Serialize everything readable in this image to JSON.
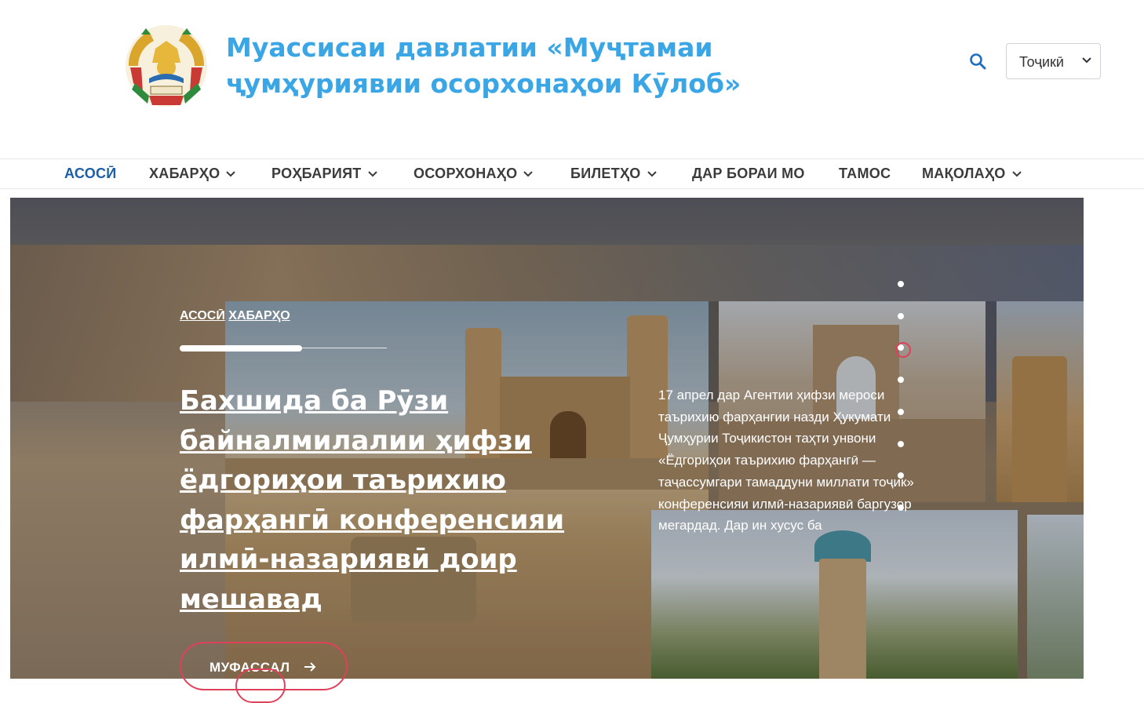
{
  "header": {
    "title_line1": "Муассисаи давлатии «Муҷтамаи",
    "title_line2": "ҷумҳуриявии осорхонаҳои Кӯлоб»",
    "brand_color": "#3aa6e6",
    "search_icon": "search-icon",
    "language_select": {
      "value": "Тоҷикӣ"
    }
  },
  "nav": {
    "items": [
      {
        "label": "АСОСӢ",
        "active": true,
        "dropdown": false
      },
      {
        "label": "ХАБАРҲО",
        "dropdown": true
      },
      {
        "label": "РОҲБАРИЯТ",
        "dropdown": true
      },
      {
        "label": "ОСОРХОНАҲО",
        "dropdown": true
      },
      {
        "label": "БИЛЕТҲО",
        "dropdown": true
      },
      {
        "label": "ДАР БОРАИ МО",
        "dropdown": false
      },
      {
        "label": "ТАМОС",
        "dropdown": false
      },
      {
        "label": "МАҚОЛАҲО",
        "dropdown": true
      }
    ],
    "active_color": "#1b5ea8"
  },
  "hero": {
    "breadcrumb": [
      "АСОСӢ",
      "ХАБАРҲО"
    ],
    "progress": 0.59,
    "headline": "Бахшида ба Рӯзи байналмилалии ҳифзи ёдгориҳои таърихию фарҳангӣ конференсияи илмӣ-назариявӣ доир мешавад",
    "excerpt": "17 апрел дар Агентии ҳифзи мероси таърихию фарҳангии назди Ҳукумати Ҷумҳурии Тоҷикистон таҳти унвони «Ёдгориҳои таърихию фарҳангӣ — таҷассумгари тамаддуни миллати тоҷик» конференсияи илмӣ-назариявӣ баргузор мегардад. Дар ин хусус ба",
    "more_button": "МУФАССАЛ",
    "slides_count": 8,
    "active_slide": 3,
    "accent_color": "#e0415a"
  }
}
